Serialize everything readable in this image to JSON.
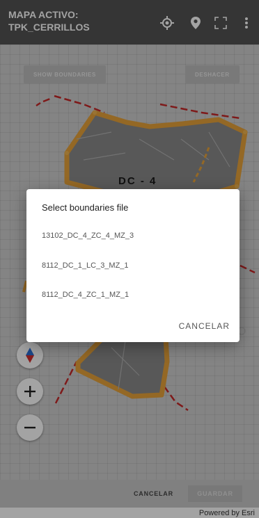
{
  "appbar": {
    "title_line1": "MAPA ACTIVO:",
    "title_line2": "TPK_CERRILLOS",
    "icons": [
      "locate-icon",
      "place-marker-icon",
      "fullscreen-icon",
      "more-vert-icon"
    ]
  },
  "map": {
    "show_boundaries_label": "SHOW BOUNDARIES",
    "undo_label": "DESHACER",
    "polygon_label": "DC - 4",
    "controls": [
      "compass-icon",
      "zoom-in-icon",
      "zoom-out-icon"
    ]
  },
  "dialog": {
    "title": "Select boundaries file",
    "items": [
      "13102_DC_4_ZC_4_MZ_3",
      "8112_DC_1_LC_3_MZ_1",
      "8112_DC_4_ZC_1_MZ_1"
    ],
    "cancel_label": "CANCELAR"
  },
  "footer": {
    "cancel_label": "CANCELAR",
    "save_label": "GUARDAR",
    "attribution": "Powered by Esri"
  },
  "colors": {
    "appbar": "#545454",
    "boundary_orange": "#e8a33a",
    "dashed_red": "#c62828",
    "map_background": "#cfcfcf"
  }
}
